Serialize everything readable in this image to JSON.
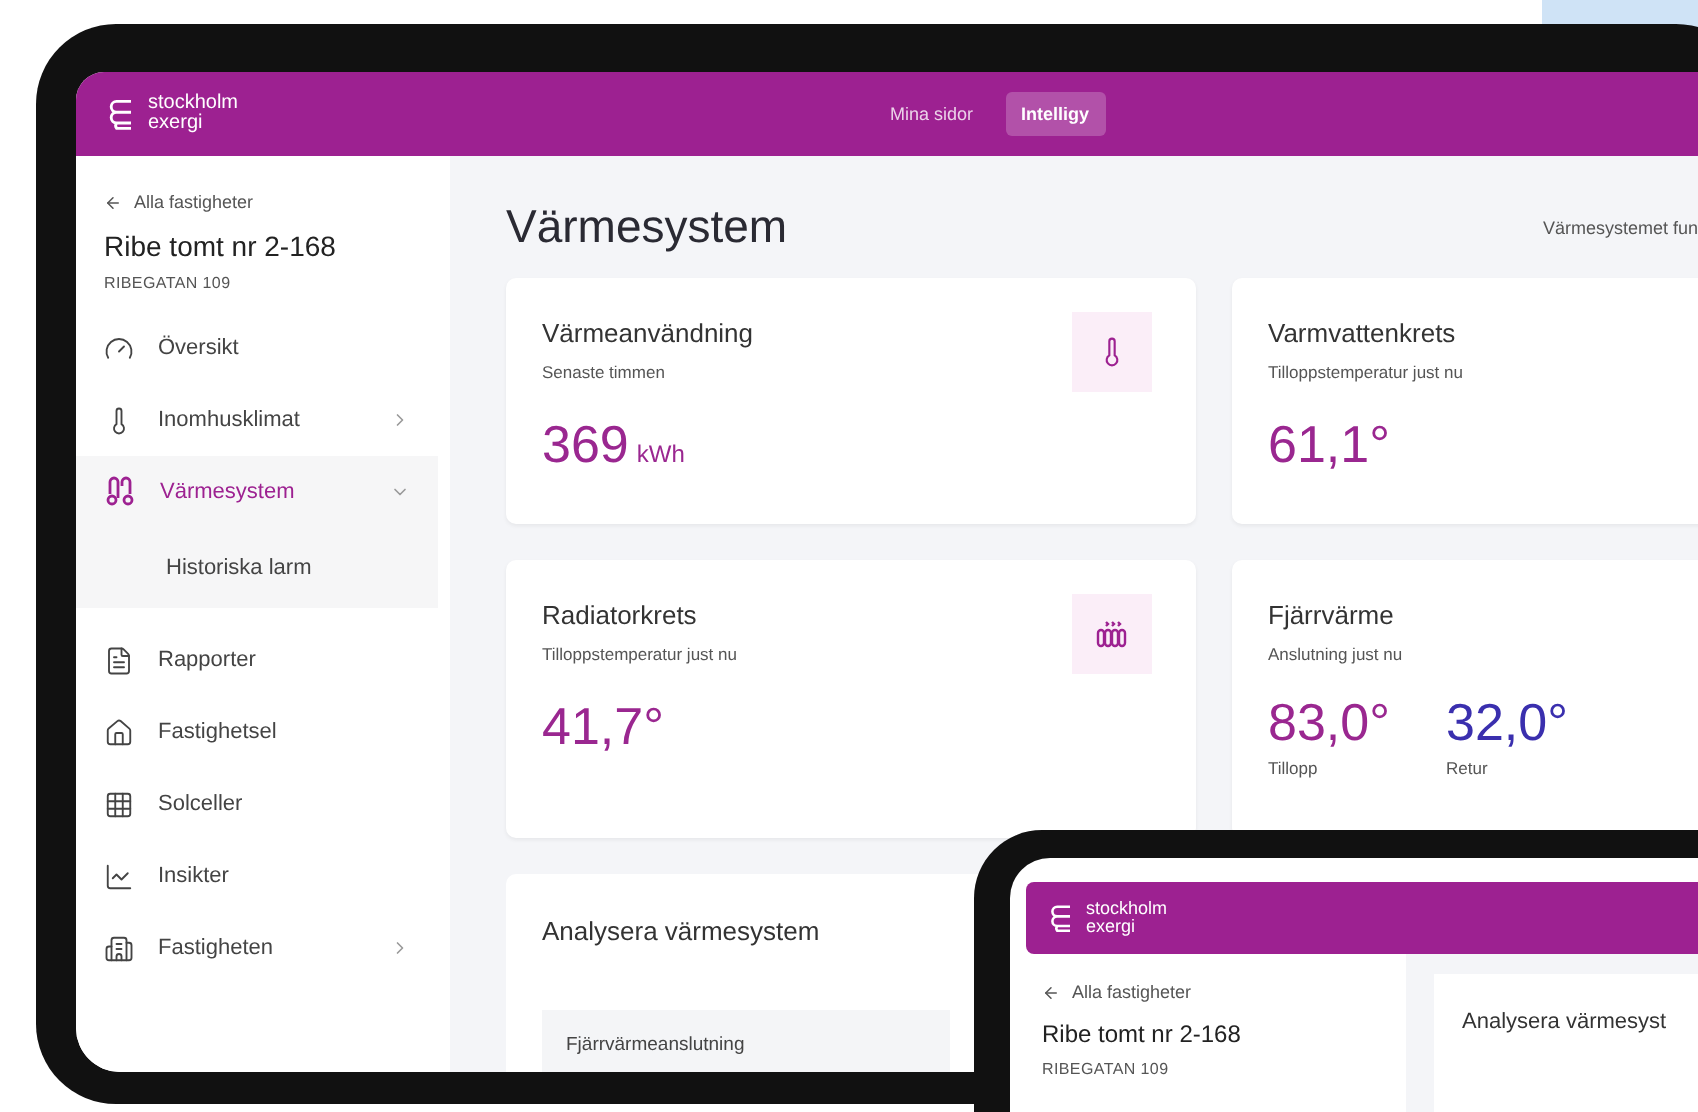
{
  "header": {
    "logo": [
      "stockholm",
      "exergi"
    ],
    "tabs": [
      {
        "label": "Mina sidor",
        "selected": false
      },
      {
        "label": "Intelligy",
        "selected": true
      }
    ]
  },
  "sidebar": {
    "back_link": "Alla fastigheter",
    "property_name": "Ribe tomt nr 2-168",
    "address": "RIBEGATAN 109",
    "items": [
      {
        "label": "Översikt",
        "selected": false
      },
      {
        "label": "Inomhusklimat",
        "selected": false,
        "expanded": false
      },
      {
        "label": "Värmesystem",
        "selected": true,
        "expanded": true,
        "children": [
          {
            "label": "Historiska larm",
            "selected": false
          }
        ]
      },
      {
        "label": "Rapporter",
        "selected": false
      },
      {
        "label": "Fastighetsel",
        "selected": false
      },
      {
        "label": "Solceller",
        "selected": false
      },
      {
        "label": "Insikter",
        "selected": false
      },
      {
        "label": "Fastigheten",
        "selected": false,
        "expanded": false
      }
    ]
  },
  "main": {
    "title": "Värmesystem",
    "status": "Värmesystemet fun",
    "cards": [
      {
        "kind": "single",
        "title": "Värmeanvändning",
        "subtitle": "Senaste timmen",
        "value": "369",
        "unit": "kWh"
      },
      {
        "kind": "single",
        "title": "Varmvattenkrets",
        "subtitle": "Tilloppstemperatur just nu",
        "value": "61,1°"
      },
      {
        "kind": "single",
        "title": "Radiatorkrets",
        "subtitle": "Tilloppstemperatur just nu",
        "value": "41,7°"
      },
      {
        "kind": "dual",
        "title": "Fjärrvärme",
        "subtitle": "Anslutning just nu",
        "readings": [
          {
            "value": "83,0°",
            "label": "Tillopp",
            "color": "#9a2790"
          },
          {
            "value": "32,0°",
            "label": "Retur",
            "color": "#3a2fae"
          }
        ]
      }
    ],
    "analysis": {
      "title": "Analysera värmesystem",
      "row": "Fjärrvärmeanslutning"
    }
  },
  "phone": {
    "logo": [
      "stockholm",
      "exergi"
    ],
    "back_link": "Alla fastigheter",
    "property_name": "Ribe tomt nr 2-168",
    "address": "RIBEGATAN 109",
    "card_title": "Analysera värmesyst"
  }
}
